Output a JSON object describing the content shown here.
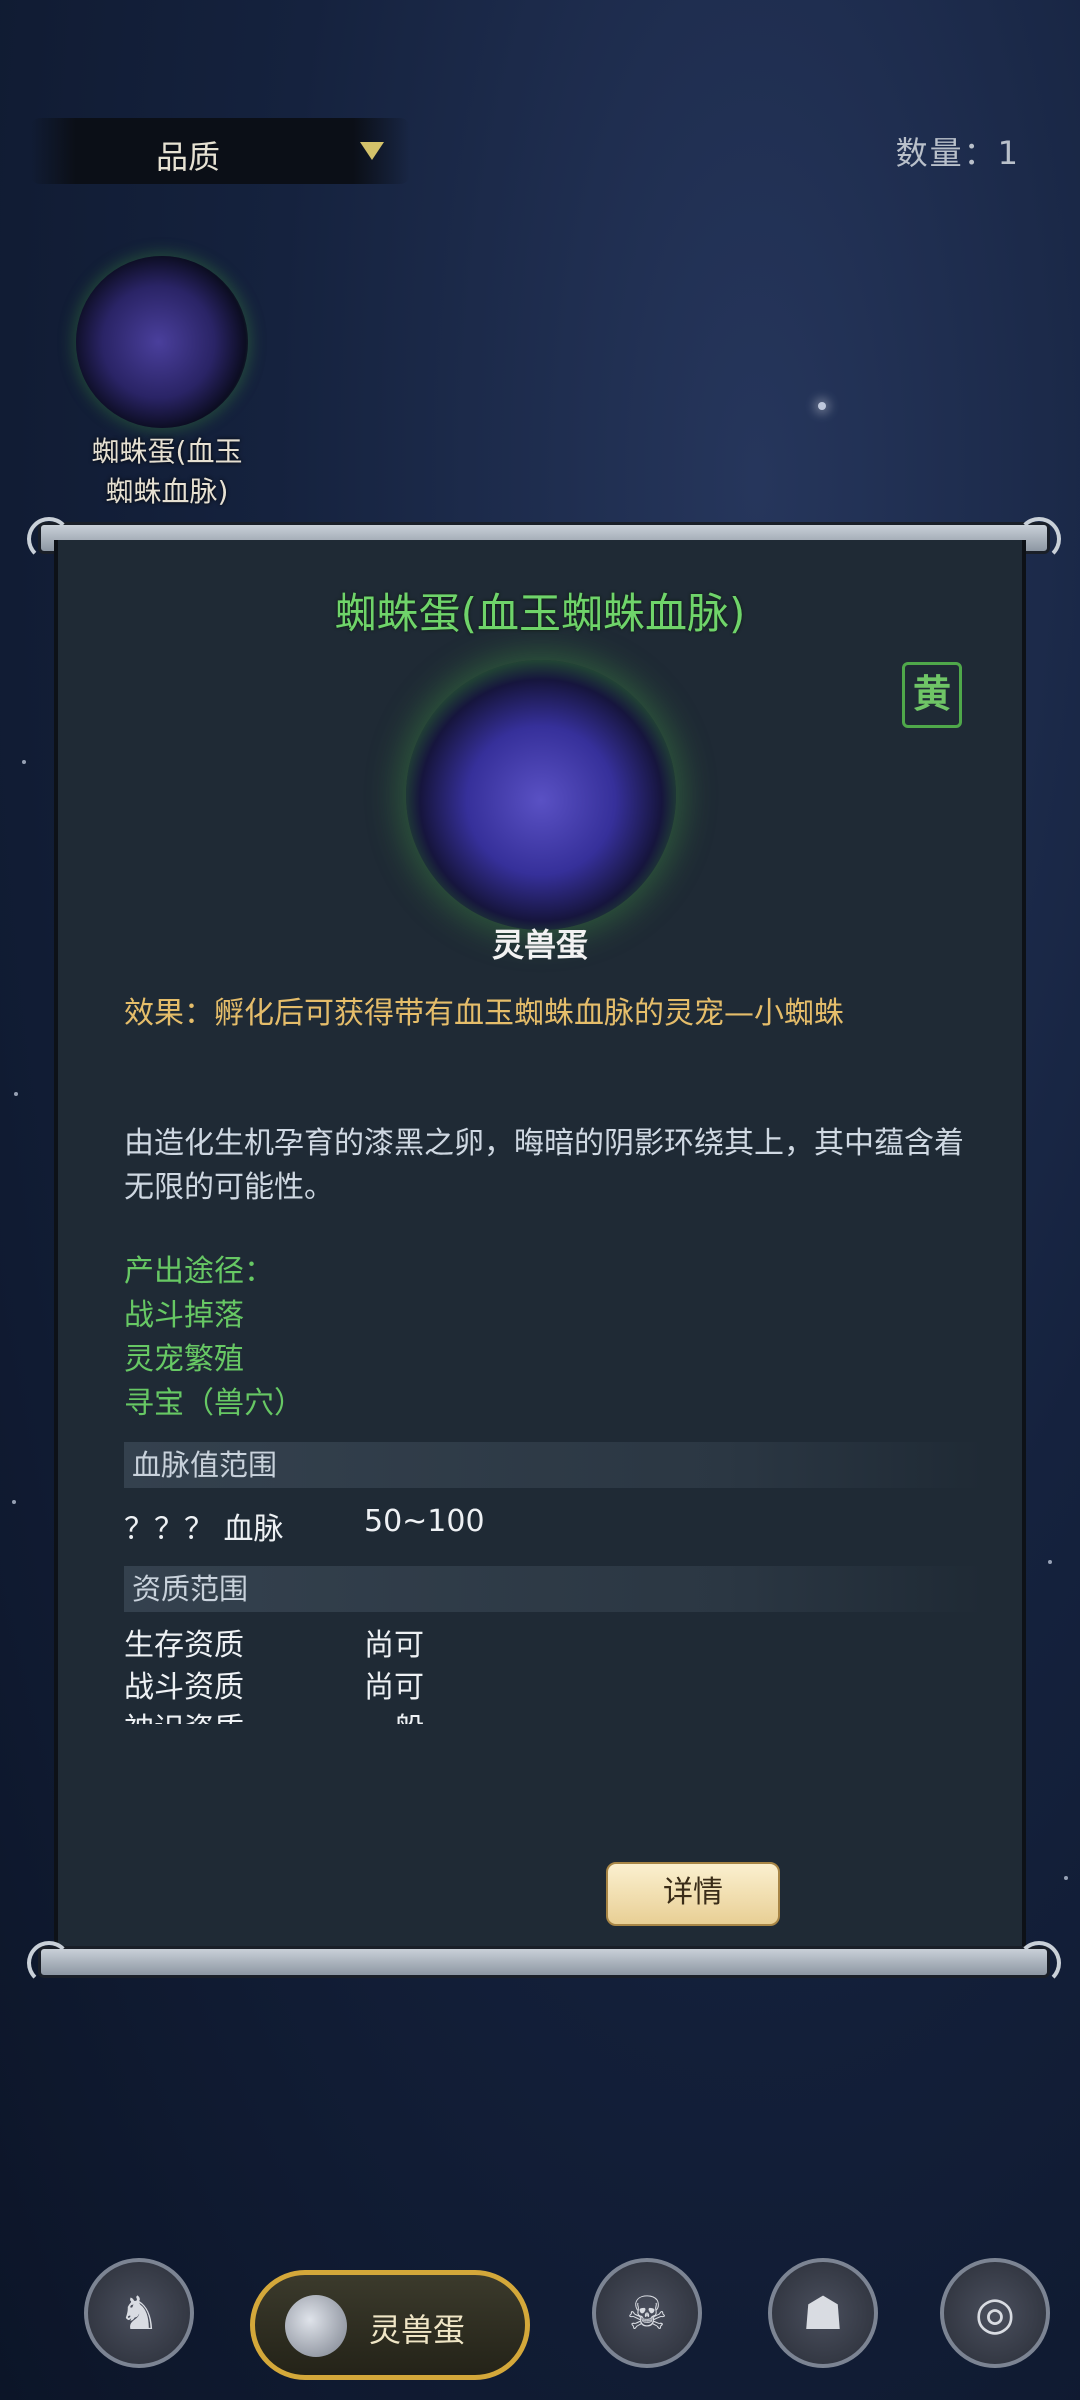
{
  "header": {
    "filter_label": "品质",
    "count_text": "数量：1"
  },
  "grid": {
    "items": [
      {
        "name": "蜘蛛蛋(血玉蜘蛛血脉)",
        "name_line1": "蜘蛛蛋(血玉",
        "name_line2": "蜘蛛血脉)"
      }
    ]
  },
  "panel": {
    "title": "蜘蛛蛋(血玉蜘蛛血脉)",
    "grade_badge": "黄",
    "item_type": "灵兽蛋",
    "effect": "效果：孵化后可获得带有血玉蜘蛛血脉的灵宠—小蜘蛛",
    "description": "由造化生机孕育的漆黑之卵，晦暗的阴影环绕其上，其中蕴含着无限的可能性。",
    "sources_heading": "产出途径：",
    "sources": [
      "战斗掉落",
      "灵宠繁殖",
      "寻宝（兽穴）"
    ],
    "bloodline_section": "血脉值范围",
    "bloodline_row": {
      "label": "？？？ 血脉",
      "value": "50~100"
    },
    "aptitude_section": "资质范围",
    "aptitudes": [
      {
        "label": "生存资质",
        "value": "尚可"
      },
      {
        "label": "战斗资质",
        "value": "尚可"
      },
      {
        "label": "神识资质",
        "value": "一般"
      }
    ],
    "detail_button": "详情"
  },
  "bottom_nav": {
    "active_label": "灵兽蛋",
    "icons": [
      "beast-icon",
      "egg-icon",
      "monster-icon",
      "totem-icon",
      "vortex-icon"
    ]
  },
  "colors": {
    "title_green": "#6fd46a",
    "effect_gold": "#e5bd6a",
    "source_green": "#67c864",
    "panel_bg": "#1f2a35"
  }
}
